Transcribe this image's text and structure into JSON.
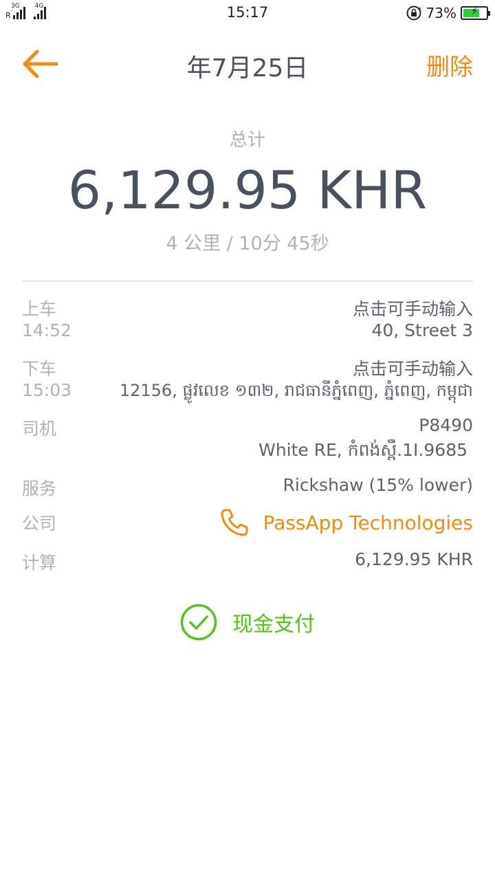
{
  "status_bar": {
    "net1": "3G",
    "net2": "4G",
    "roaming": "R",
    "time": "15:17",
    "battery_percent": "73%",
    "battery_level": 0.73,
    "icons": [
      "signal-icon",
      "rotation-lock-icon",
      "battery-charging-icon"
    ]
  },
  "header": {
    "title": "年7月25日",
    "delete_label": "删除",
    "accent_color": "#f28c0f"
  },
  "summary": {
    "total_label": "总计",
    "total_amount": "6,129.95 KHR",
    "distance_time": "4 公里 / 10分 45秒"
  },
  "details": {
    "pickup": {
      "label": "上车",
      "time": "14:52",
      "hint": "点击可手动输入",
      "address": "40, Street 3"
    },
    "dropoff": {
      "label": "下车",
      "time": "15:03",
      "hint": "点击可手动输入",
      "address": "12156, ផ្លូវលេខ ១៣២, រាជធានីភ្នំពេញ, ភ្នំពេញ, កម្ពុជា"
    },
    "driver": {
      "label": "司机",
      "plate": "P8490",
      "vehicle": "White RE, កំពង់ស្ពឺ.1I.9685"
    },
    "service": {
      "label": "服务",
      "value": "Rickshaw (15% lower)"
    },
    "company": {
      "label": "公司",
      "value": "PassApp Technologies",
      "icon": "phone-icon"
    },
    "calculation": {
      "label": "计算",
      "value": "6,129.95 KHR"
    }
  },
  "payment": {
    "label": "现金支付",
    "icon": "check-circle-icon",
    "color": "#52c41a"
  }
}
